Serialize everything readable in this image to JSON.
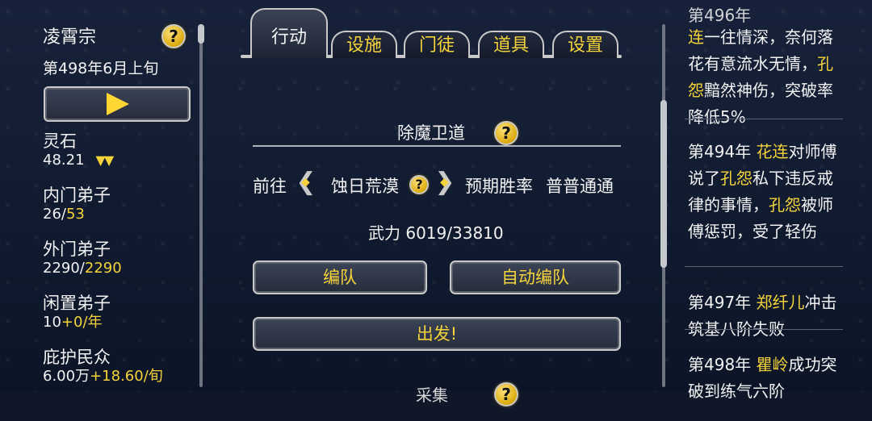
{
  "left": {
    "sect_name": "凌霄宗",
    "help": "?",
    "date": "第498年6月上旬",
    "stats": [
      {
        "label": "灵石",
        "value": "48.21",
        "suffix": "▼▼"
      },
      {
        "label": "内门弟子",
        "value": "26/",
        "value_hl": "53"
      },
      {
        "label": "外门弟子",
        "value": "2290/",
        "value_hl": "2290"
      },
      {
        "label": "闲置弟子",
        "value": "10",
        "value_hl": "+0/年"
      },
      {
        "label": "庇护民众",
        "value": "6.00万",
        "value_hl": "+18.60/旬"
      }
    ]
  },
  "tabs": [
    "行动",
    "设施",
    "门徒",
    "道具",
    "设置"
  ],
  "main": {
    "title": "除魔卫道",
    "help": "?",
    "goto": "前往",
    "location": "蚀日荒漠",
    "win_label": "预期胜率",
    "win_value": "普普通通",
    "power": "武力 6019/33810",
    "btn_team": "编队",
    "btn_auto": "自动编队",
    "btn_go": "出发!",
    "next_title": "采集"
  },
  "log": {
    "top_partial": "第496年",
    "entry0": {
      "p1": "连",
      "p2": "一往情深，奈何落花有意流水无情，",
      "p3": "孔怨",
      "p4": "黯然神伤，突破率降低5%"
    },
    "entry1": {
      "p1": "第494年 ",
      "p2": "花连",
      "p3": "对师傅说了",
      "p4": "孔怨",
      "p5": "私下违反戒律的事情，",
      "p6": "孔怨",
      "p7": "被师傅惩罚，受了轻伤"
    },
    "entry2": {
      "p1": "第497年 ",
      "p2": "郑纤儿",
      "p3": "冲击筑基八阶失败"
    },
    "entry3": {
      "p1": "第498年 ",
      "p2": "瞿岭",
      "p3": "成功突破到练气六阶"
    }
  },
  "colors": {
    "highlight": "#f5d33a",
    "background": "#0f1729",
    "frame": "#c9c9c9"
  }
}
